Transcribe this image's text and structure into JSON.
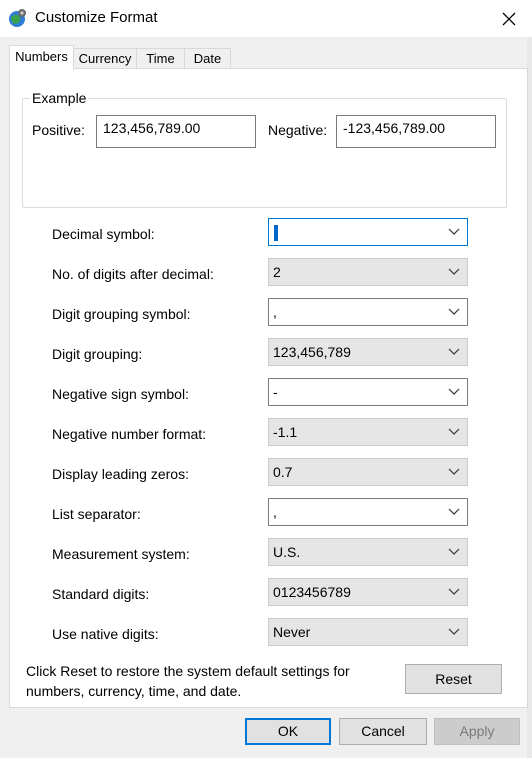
{
  "window": {
    "title": "Customize Format",
    "close_icon": "close-icon",
    "app_icon": "globe-settings-icon"
  },
  "tabs": [
    {
      "label": "Numbers",
      "active": true
    },
    {
      "label": "Currency",
      "active": false
    },
    {
      "label": "Time",
      "active": false
    },
    {
      "label": "Date",
      "active": false
    }
  ],
  "example": {
    "legend": "Example",
    "positive_label": "Positive:",
    "positive_value": "123,456,789.00",
    "negative_label": "Negative:",
    "negative_value": "-123,456,789.00"
  },
  "settings": [
    {
      "label": "Decimal symbol:",
      "value": ".",
      "editable": true,
      "focused": true
    },
    {
      "label": "No. of digits after decimal:",
      "value": "2",
      "editable": false
    },
    {
      "label": "Digit grouping symbol:",
      "value": ",",
      "editable": true
    },
    {
      "label": "Digit grouping:",
      "value": "123,456,789",
      "editable": false
    },
    {
      "label": "Negative sign symbol:",
      "value": "-",
      "editable": true
    },
    {
      "label": "Negative number format:",
      "value": "-1.1",
      "editable": false
    },
    {
      "label": "Display leading zeros:",
      "value": "0.7",
      "editable": false
    },
    {
      "label": "List separator:",
      "value": ",",
      "editable": true
    },
    {
      "label": "Measurement system:",
      "value": "U.S.",
      "editable": false
    },
    {
      "label": "Standard digits:",
      "value": "0123456789",
      "editable": false
    },
    {
      "label": "Use native digits:",
      "value": "Never",
      "editable": false
    }
  ],
  "reset_info": {
    "line1": "Click Reset to restore the system default settings for",
    "line2": "numbers, currency, time, and date.",
    "button": "Reset"
  },
  "buttons": {
    "ok": "OK",
    "cancel": "Cancel",
    "apply": "Apply"
  },
  "colors": {
    "accent": "#0078d7",
    "dialog_bg": "#f0f0f0",
    "panel_bg": "#ffffff",
    "dropdown_bg": "#e5e5e5"
  }
}
